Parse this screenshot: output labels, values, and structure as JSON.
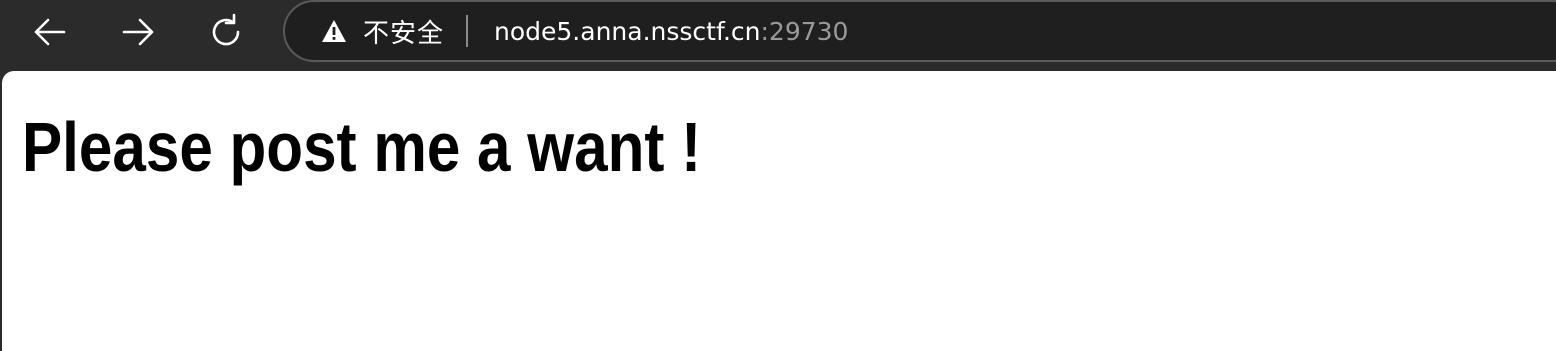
{
  "browser": {
    "security_label": "不安全",
    "url_host": "node5.anna.nssctf.cn",
    "url_port": ":29730",
    "icons": {
      "back": "back-arrow-icon",
      "forward": "forward-arrow-icon",
      "reload": "reload-icon",
      "security": "warning-triangle-icon"
    },
    "colors": {
      "toolbar_bg": "#2b2b2b",
      "omnibox_bg": "#1f1f1f",
      "url_port": "#9a9a9a"
    }
  },
  "page": {
    "heading": "Please post me a want !"
  }
}
